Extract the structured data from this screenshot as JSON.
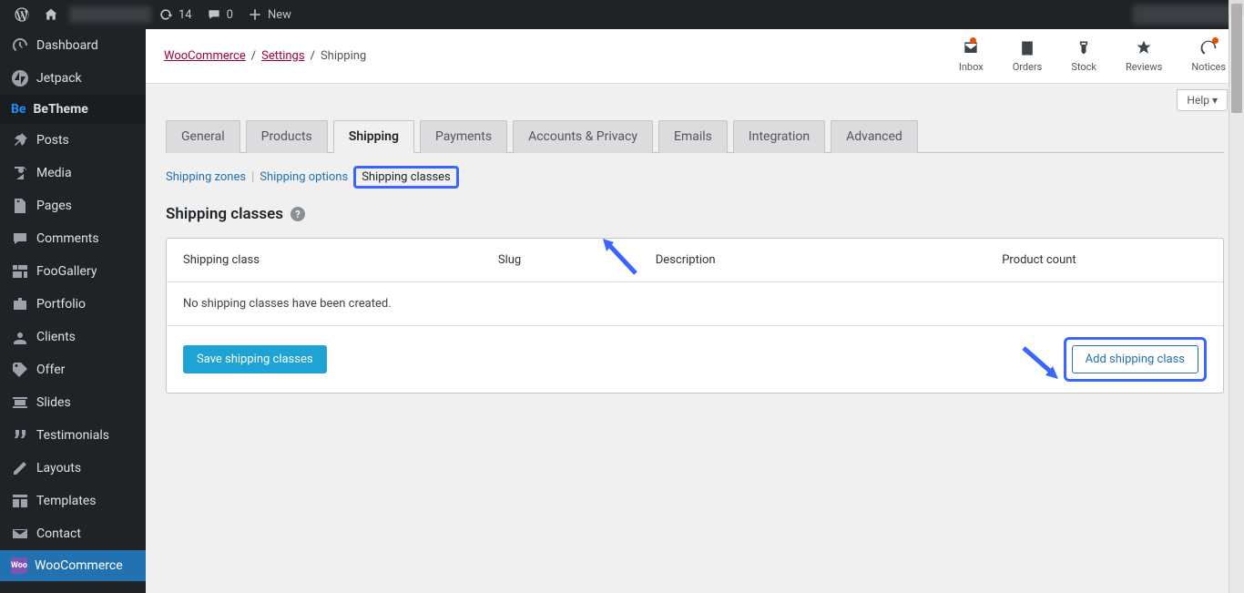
{
  "adminbar": {
    "refresh_count": "14",
    "comment_count": "0",
    "new_label": "New"
  },
  "sidebar": {
    "items": [
      {
        "label": "Dashboard",
        "icon": "dashboard"
      },
      {
        "label": "Jetpack",
        "icon": "jetpack"
      },
      {
        "label": "BeTheme",
        "icon": "be"
      },
      {
        "label": "Posts",
        "icon": "pin"
      },
      {
        "label": "Media",
        "icon": "media"
      },
      {
        "label": "Pages",
        "icon": "page"
      },
      {
        "label": "Comments",
        "icon": "comment"
      },
      {
        "label": "FooGallery",
        "icon": "gallery"
      },
      {
        "label": "Portfolio",
        "icon": "portfolio"
      },
      {
        "label": "Clients",
        "icon": "clients"
      },
      {
        "label": "Offer",
        "icon": "offer"
      },
      {
        "label": "Slides",
        "icon": "slides"
      },
      {
        "label": "Testimonials",
        "icon": "quote"
      },
      {
        "label": "Layouts",
        "icon": "layouts"
      },
      {
        "label": "Templates",
        "icon": "templates"
      },
      {
        "label": "Contact",
        "icon": "contact"
      },
      {
        "label": "WooCommerce",
        "icon": "woo"
      }
    ]
  },
  "breadcrumb": {
    "l1": "WooCommerce",
    "l2": "Settings",
    "l3": "Shipping"
  },
  "topIcons": {
    "inbox": "Inbox",
    "orders": "Orders",
    "stock": "Stock",
    "reviews": "Reviews",
    "notices": "Notices"
  },
  "helpBtn": "Help ▾",
  "tabs": [
    "General",
    "Products",
    "Shipping",
    "Payments",
    "Accounts & Privacy",
    "Emails",
    "Integration",
    "Advanced"
  ],
  "activeTab": "Shipping",
  "subTabs": {
    "zones": "Shipping zones",
    "options": "Shipping options",
    "classes": "Shipping classes"
  },
  "section": {
    "title": "Shipping classes",
    "cols": {
      "c1": "Shipping class",
      "c2": "Slug",
      "c3": "Description",
      "c4": "Product count"
    },
    "empty": "No shipping classes have been created.",
    "saveBtn": "Save shipping classes",
    "addBtn": "Add shipping class"
  }
}
